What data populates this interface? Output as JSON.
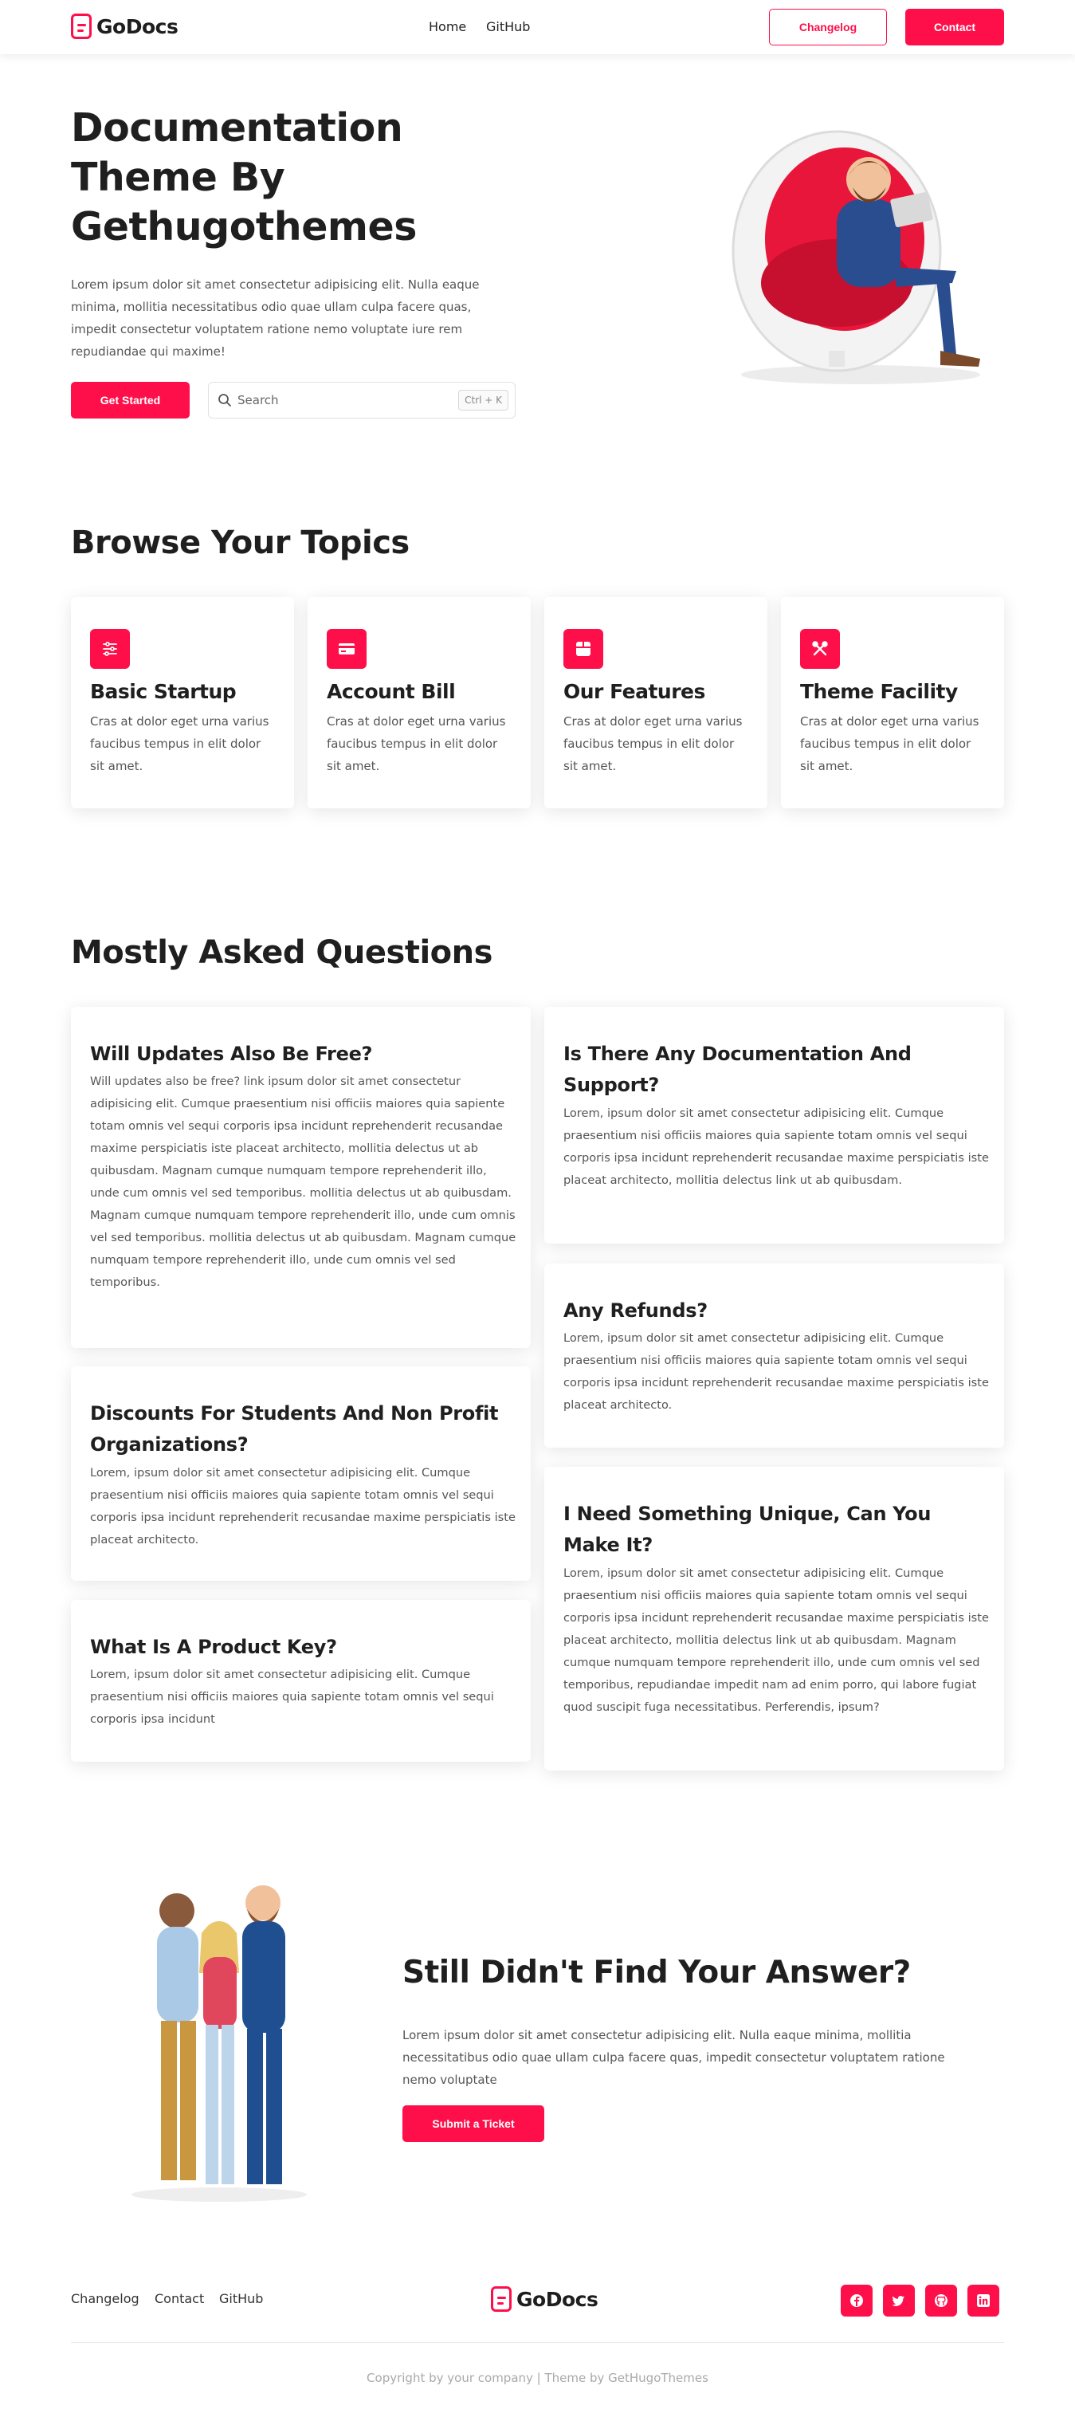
{
  "brand": {
    "name": "GoDocs",
    "accent": "#fe0f4a"
  },
  "nav": {
    "links": [
      "Home",
      "GitHub"
    ],
    "changelog_label": "Changelog",
    "contact_label": "Contact"
  },
  "hero": {
    "title": "Documentation Theme By Gethugothemes",
    "description": "Lorem ipsum dolor sit amet consectetur adipisicing elit. Nulla eaque minima, mollitia necessitatibus odio quae ullam culpa facere quas, impedit consectetur voluptatem ratione nemo voluptate iure rem repudiandae qui maxime!",
    "cta_label": "Get Started",
    "search": {
      "placeholder": "Search",
      "shortcut": "Ctrl + K"
    },
    "illustration_icon": "man-in-egg-chair-with-laptop-illustration"
  },
  "topics": {
    "heading": "Browse Your Topics",
    "items": [
      {
        "icon": "sliders-icon",
        "title": "Basic Startup",
        "description": "Cras at dolor eget urna varius faucibus tempus in elit dolor sit amet."
      },
      {
        "icon": "credit-card-icon",
        "title": "Account Bill",
        "description": "Cras at dolor eget urna varius faucibus tempus in elit dolor sit amet."
      },
      {
        "icon": "box-icon",
        "title": "Our Features",
        "description": "Cras at dolor eget urna varius faucibus tempus in elit dolor sit amet."
      },
      {
        "icon": "tools-icon",
        "title": "Theme Facility",
        "description": "Cras at dolor eget urna varius faucibus tempus in elit dolor sit amet."
      }
    ]
  },
  "faq": {
    "heading": "Mostly Asked Questions",
    "left": [
      {
        "question": "Will Updates Also Be Free?",
        "answer": "Will updates also be free? link ipsum dolor sit amet consectetur adipisicing elit. Cumque praesentium nisi officiis maiores quia sapiente totam omnis vel sequi corporis ipsa incidunt reprehenderit recusandae maxime perspiciatis iste placeat architecto, mollitia delectus ut ab quibusdam. Magnam cumque numquam tempore reprehenderit illo, unde cum omnis vel sed temporibus. mollitia delectus ut ab quibusdam. Magnam cumque numquam tempore reprehenderit illo, unde cum omnis vel sed temporibus. mollitia delectus ut ab quibusdam. Magnam cumque numquam tempore reprehenderit illo, unde cum omnis vel sed temporibus."
      },
      {
        "question": "Discounts For Students And Non Profit Organizations?",
        "answer": "Lorem, ipsum dolor sit amet consectetur adipisicing elit. Cumque praesentium nisi officiis maiores quia sapiente totam omnis vel sequi corporis ipsa incidunt reprehenderit recusandae maxime perspiciatis iste placeat architecto."
      },
      {
        "question": "What Is A Product Key?",
        "answer": "Lorem, ipsum dolor sit amet consectetur adipisicing elit. Cumque praesentium nisi officiis maiores quia sapiente totam omnis vel sequi corporis ipsa incidunt"
      }
    ],
    "right": [
      {
        "question": "Is There Any Documentation And Support?",
        "answer": "Lorem, ipsum dolor sit amet consectetur adipisicing elit. Cumque praesentium nisi officiis maiores quia sapiente totam omnis vel sequi corporis ipsa incidunt reprehenderit recusandae maxime perspiciatis iste placeat architecto, mollitia delectus link ut ab quibusdam."
      },
      {
        "question": "Any Refunds?",
        "answer": "Lorem, ipsum dolor sit amet consectetur adipisicing elit. Cumque praesentium nisi officiis maiores quia sapiente totam omnis vel sequi corporis ipsa incidunt reprehenderit recusandae maxime perspiciatis iste placeat architecto."
      },
      {
        "question": "I Need Something Unique, Can You Make It?",
        "answer": "Lorem, ipsum dolor sit amet consectetur adipisicing elit. Cumque praesentium nisi officiis maiores quia sapiente totam omnis vel sequi corporis ipsa incidunt reprehenderit recusandae maxime perspiciatis iste placeat architecto, mollitia delectus link ut ab quibusdam. Magnam cumque numquam tempore reprehenderit illo, unde cum omnis vel sed temporibus, repudiandae impedit nam ad enim porro, qui labore fugiat quod suscipit fuga necessitatibus. Perferendis, ipsum?"
      }
    ]
  },
  "cta": {
    "title": "Still Didn't Find Your Answer?",
    "description": "Lorem ipsum dolor sit amet consectetur adipisicing elit. Nulla eaque minima, mollitia necessitatibus odio quae ullam culpa facere quas, impedit consectetur voluptatem ratione nemo voluptate",
    "button_label": "Submit a Ticket",
    "illustration_icon": "three-people-illustration"
  },
  "footer": {
    "links": [
      "Changelog",
      "Contact",
      "GitHub"
    ],
    "social": [
      "facebook-icon",
      "twitter-icon",
      "github-icon",
      "linkedin-icon"
    ],
    "copyright": "Copyright by your company | Theme by GetHugoThemes"
  }
}
